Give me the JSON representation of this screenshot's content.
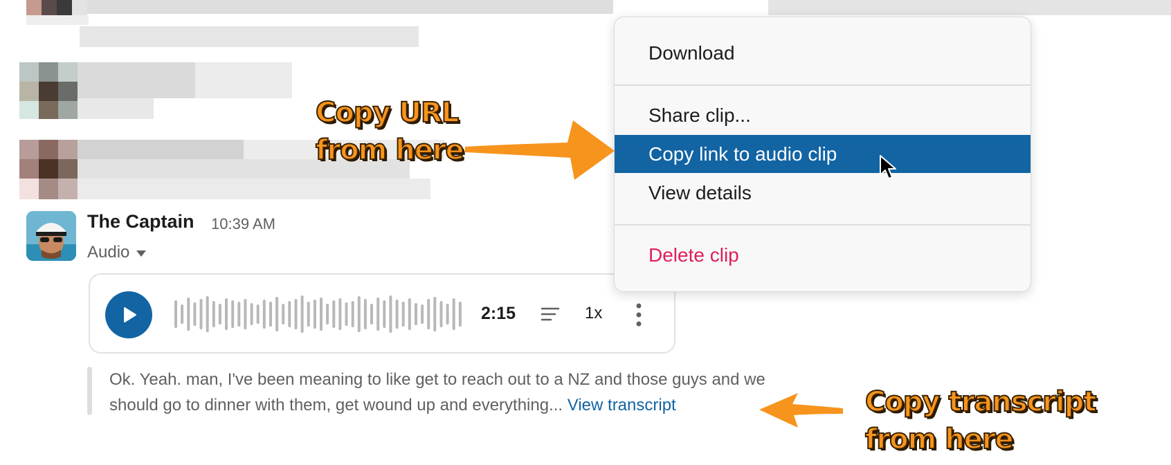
{
  "message": {
    "author": "The Captain",
    "time": "10:39 AM",
    "attachment_label": "Audio",
    "player": {
      "duration": "2:15",
      "speed": "1x"
    },
    "transcript_preview": "Ok. Yeah. man, I've been meaning to like get to reach out to a NZ and those guys and we should go to dinner with them, get wound up and everything...",
    "view_transcript_label": "View transcript"
  },
  "context_menu": {
    "items": [
      {
        "label": "Download"
      },
      {
        "label": "Share clip..."
      },
      {
        "label": "Copy link to audio clip",
        "highlighted": true
      },
      {
        "label": "View details"
      },
      {
        "label": "Delete clip",
        "destructive": true
      }
    ]
  },
  "annotations": {
    "url_callout_line1": "Copy URL",
    "url_callout_line2": "from here",
    "transcript_callout_line1": "Copy transcript",
    "transcript_callout_line2": "from here"
  },
  "colors": {
    "accent": "#1264a3",
    "destructive": "#e01e5a",
    "annotation": "#f7941d"
  }
}
